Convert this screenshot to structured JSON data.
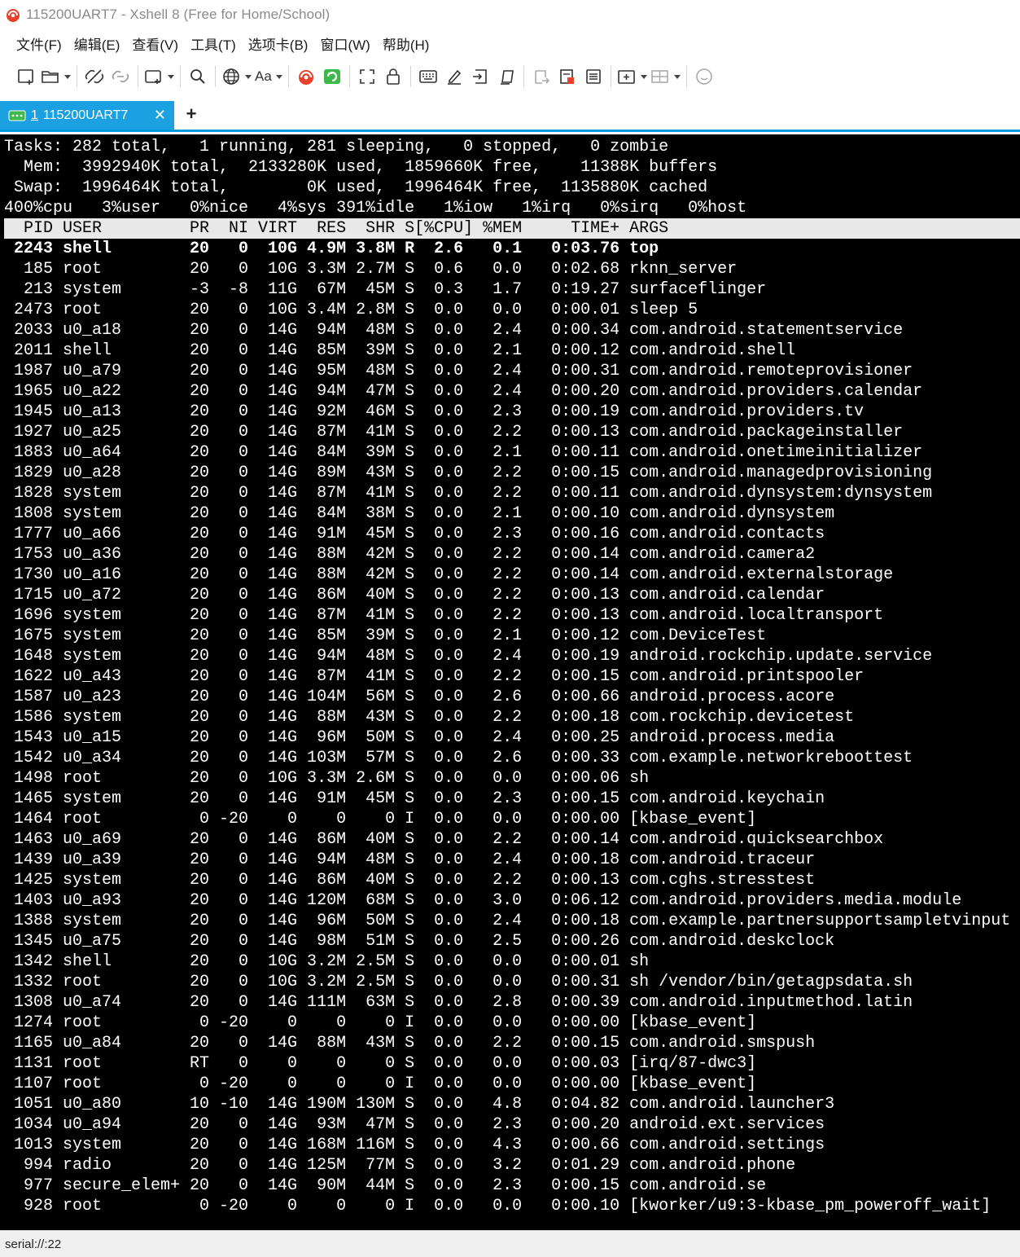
{
  "window": {
    "title": "115200UART7 - Xshell 8 (Free for Home/School)"
  },
  "colors": {
    "accent": "#1ba1e2",
    "tab_underline": "#0099db",
    "terminal_bg": "#000000",
    "terminal_fg": "#ffffff",
    "header_row_bg": "#e8e8e8",
    "xshell_red": "#e8402a",
    "xftp_green": "#3cb94a"
  },
  "menu": [
    "文件(F)",
    "编辑(E)",
    "查看(V)",
    "工具(T)",
    "选项卡(B)",
    "窗口(W)",
    "帮助(H)"
  ],
  "toolbar": {
    "font_label": "Aa",
    "icons": [
      "new-session-icon",
      "open-folder-icon",
      "disconnect-icon",
      "reconnect-icon",
      "new-window-icon",
      "search-icon",
      "globe-icon",
      "font-icon",
      "xshell-logo-icon",
      "xftp-icon",
      "fullscreen-icon",
      "lock-icon",
      "keyboard-icon",
      "highlight-icon",
      "script-icon",
      "macro-icon",
      "compose-icon",
      "record-icon",
      "log-icon",
      "new-tab-icon",
      "layout-icon",
      "chat-icon"
    ]
  },
  "tab": {
    "number": "1",
    "label": "115200UART7",
    "close": "✕",
    "add": "+"
  },
  "terminal": {
    "lines": [
      "Tasks: 282 total,   1 running, 281 sleeping,   0 stopped,   0 zombie",
      "  Mem:  3992940K total,  2133280K used,  1859660K free,    11388K buffers",
      " Swap:  1996464K total,        0K used,  1996464K free,  1135880K cached",
      "400%cpu   3%user   0%nice   4%sys 391%idle   1%iow   1%irq   0%sirq   0%host",
      "  PID USER         PR  NI VIRT  RES  SHR S[%CPU] %MEM     TIME+ ARGS",
      " 2243 shell        20   0  10G 4.9M 3.8M R  2.6   0.1   0:03.76 top",
      "  185 root         20   0  10G 3.3M 2.7M S  0.6   0.0   0:02.68 rknn_server",
      "  213 system       -3  -8  11G  67M  45M S  0.3   1.7   0:19.27 surfaceflinger",
      " 2473 root         20   0  10G 3.4M 2.8M S  0.0   0.0   0:00.01 sleep 5",
      " 2033 u0_a18       20   0  14G  94M  48M S  0.0   2.4   0:00.34 com.android.statementservice",
      " 2011 shell        20   0  14G  85M  39M S  0.0   2.1   0:00.12 com.android.shell",
      " 1987 u0_a79       20   0  14G  95M  48M S  0.0   2.4   0:00.31 com.android.remoteprovisioner",
      " 1965 u0_a22       20   0  14G  94M  47M S  0.0   2.4   0:00.20 com.android.providers.calendar",
      " 1945 u0_a13       20   0  14G  92M  46M S  0.0   2.3   0:00.19 com.android.providers.tv",
      " 1927 u0_a25       20   0  14G  87M  41M S  0.0   2.2   0:00.13 com.android.packageinstaller",
      " 1883 u0_a64       20   0  14G  84M  39M S  0.0   2.1   0:00.11 com.android.onetimeinitializer",
      " 1829 u0_a28       20   0  14G  89M  43M S  0.0   2.2   0:00.15 com.android.managedprovisioning",
      " 1828 system       20   0  14G  87M  41M S  0.0   2.2   0:00.11 com.android.dynsystem:dynsystem",
      " 1808 system       20   0  14G  84M  38M S  0.0   2.1   0:00.10 com.android.dynsystem",
      " 1777 u0_a66       20   0  14G  91M  45M S  0.0   2.3   0:00.16 com.android.contacts",
      " 1753 u0_a36       20   0  14G  88M  42M S  0.0   2.2   0:00.14 com.android.camera2",
      " 1730 u0_a16       20   0  14G  88M  42M S  0.0   2.2   0:00.14 com.android.externalstorage",
      " 1715 u0_a72       20   0  14G  86M  40M S  0.0   2.2   0:00.13 com.android.calendar",
      " 1696 system       20   0  14G  87M  41M S  0.0   2.2   0:00.13 com.android.localtransport",
      " 1675 system       20   0  14G  85M  39M S  0.0   2.1   0:00.12 com.DeviceTest",
      " 1648 system       20   0  14G  94M  48M S  0.0   2.4   0:00.19 android.rockchip.update.service",
      " 1622 u0_a43       20   0  14G  87M  41M S  0.0   2.2   0:00.15 com.android.printspooler",
      " 1587 u0_a23       20   0  14G 104M  56M S  0.0   2.6   0:00.66 android.process.acore",
      " 1586 system       20   0  14G  88M  43M S  0.0   2.2   0:00.18 com.rockchip.devicetest",
      " 1543 u0_a15       20   0  14G  96M  50M S  0.0   2.4   0:00.25 android.process.media",
      " 1542 u0_a34       20   0  14G 103M  57M S  0.0   2.6   0:00.33 com.example.networkreboottest",
      " 1498 root         20   0  10G 3.3M 2.6M S  0.0   0.0   0:00.06 sh",
      " 1465 system       20   0  14G  91M  45M S  0.0   2.3   0:00.15 com.android.keychain",
      " 1464 root          0 -20    0    0    0 I  0.0   0.0   0:00.00 [kbase_event]",
      " 1463 u0_a69       20   0  14G  86M  40M S  0.0   2.2   0:00.14 com.android.quicksearchbox",
      " 1439 u0_a39       20   0  14G  94M  48M S  0.0   2.4   0:00.18 com.android.traceur",
      " 1425 system       20   0  14G  86M  40M S  0.0   2.2   0:00.13 com.cghs.stresstest",
      " 1403 u0_a93       20   0  14G 120M  68M S  0.0   3.0   0:06.12 com.android.providers.media.module",
      " 1388 system       20   0  14G  96M  50M S  0.0   2.4   0:00.18 com.example.partnersupportsampletvinput",
      " 1345 u0_a75       20   0  14G  98M  51M S  0.0   2.5   0:00.26 com.android.deskclock",
      " 1342 shell        20   0  10G 3.2M 2.5M S  0.0   0.0   0:00.01 sh",
      " 1332 root         20   0  10G 3.2M 2.5M S  0.0   0.0   0:00.31 sh /vendor/bin/getagpsdata.sh",
      " 1308 u0_a74       20   0  14G 111M  63M S  0.0   2.8   0:00.39 com.android.inputmethod.latin",
      " 1274 root          0 -20    0    0    0 I  0.0   0.0   0:00.00 [kbase_event]",
      " 1165 u0_a84       20   0  14G  88M  43M S  0.0   2.2   0:00.15 com.android.smspush",
      " 1131 root         RT   0    0    0    0 S  0.0   0.0   0:00.03 [irq/87-dwc3]",
      " 1107 root          0 -20    0    0    0 I  0.0   0.0   0:00.00 [kbase_event]",
      " 1051 u0_a80       10 -10  14G 190M 130M S  0.0   4.8   0:04.82 com.android.launcher3",
      " 1034 u0_a94       20   0  14G  93M  47M S  0.0   2.3   0:00.20 android.ext.services",
      " 1013 system       20   0  14G 168M 116M S  0.0   4.3   0:00.66 com.android.settings",
      "  994 radio        20   0  14G 125M  77M S  0.0   3.2   0:01.29 com.android.phone",
      "  977 secure_elem+ 20   0  14G  90M  44M S  0.0   2.3   0:00.15 com.android.se",
      "  928 root          0 -20    0    0    0 I  0.0   0.0   0:00.10 [kworker/u9:3-kbase_pm_poweroff_wait]"
    ]
  },
  "status": {
    "text": "serial://:22"
  }
}
